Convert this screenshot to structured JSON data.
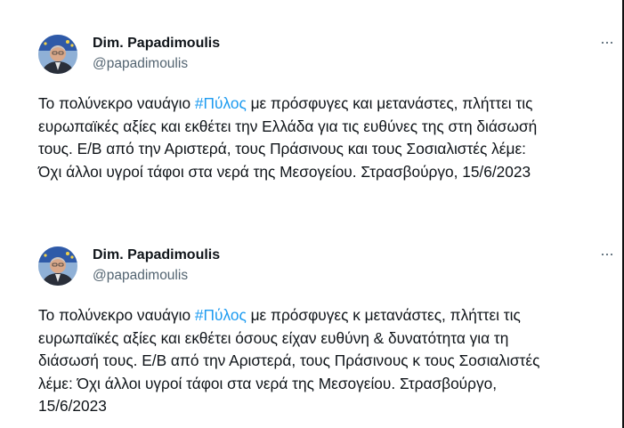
{
  "tweets": [
    {
      "author_name": "Dim. Papadimoulis",
      "handle": "@papadimoulis",
      "more_label": "···",
      "lines": [
        {
          "pre": "Το πολύνεκρο ναυάγιο ",
          "hashtag": "#Πύλος",
          "post": " με πρόσφυγες και μετανάστες, πλήττει τις"
        },
        {
          "text": "ευρωπαϊκές αξίες και εκθέτει την Ελλάδα για τις ευθύνες της στη διάσωσή"
        },
        {
          "text": "τους. Ε/Β από την Αριστερά, τους Πράσινους και τους Σοσιαλιστές λέμε:"
        },
        {
          "text": "Όχι άλλοι υγροί τάφοι στα νερά της Μεσογείου. Στρασβούργο, 15/6/2023"
        }
      ]
    },
    {
      "author_name": "Dim. Papadimoulis",
      "handle": "@papadimoulis",
      "more_label": "···",
      "lines": [
        {
          "pre": "Το πολύνεκρο ναυάγιο ",
          "hashtag": "#Πύλος",
          "post": " με πρόσφυγες κ μετανάστες, πλήττει τις"
        },
        {
          "text": "ευρωπαϊκές αξίες και εκθέτει όσους είχαν ευθύνη & δυνατότητα για τη"
        },
        {
          "text": "διάσωσή τους. Ε/Β από την Αριστερά, τους Πράσινους κ τους Σοσιαλιστές"
        },
        {
          "text": "λέμε: Όχι άλλοι υγροί τάφοι στα νερά της Μεσογείου. Στρασβούργο,"
        },
        {
          "text": "15/6/2023"
        }
      ]
    }
  ],
  "colors": {
    "text": "#0f1419",
    "secondary": "#536471",
    "hashtag": "#1d9bf0"
  }
}
